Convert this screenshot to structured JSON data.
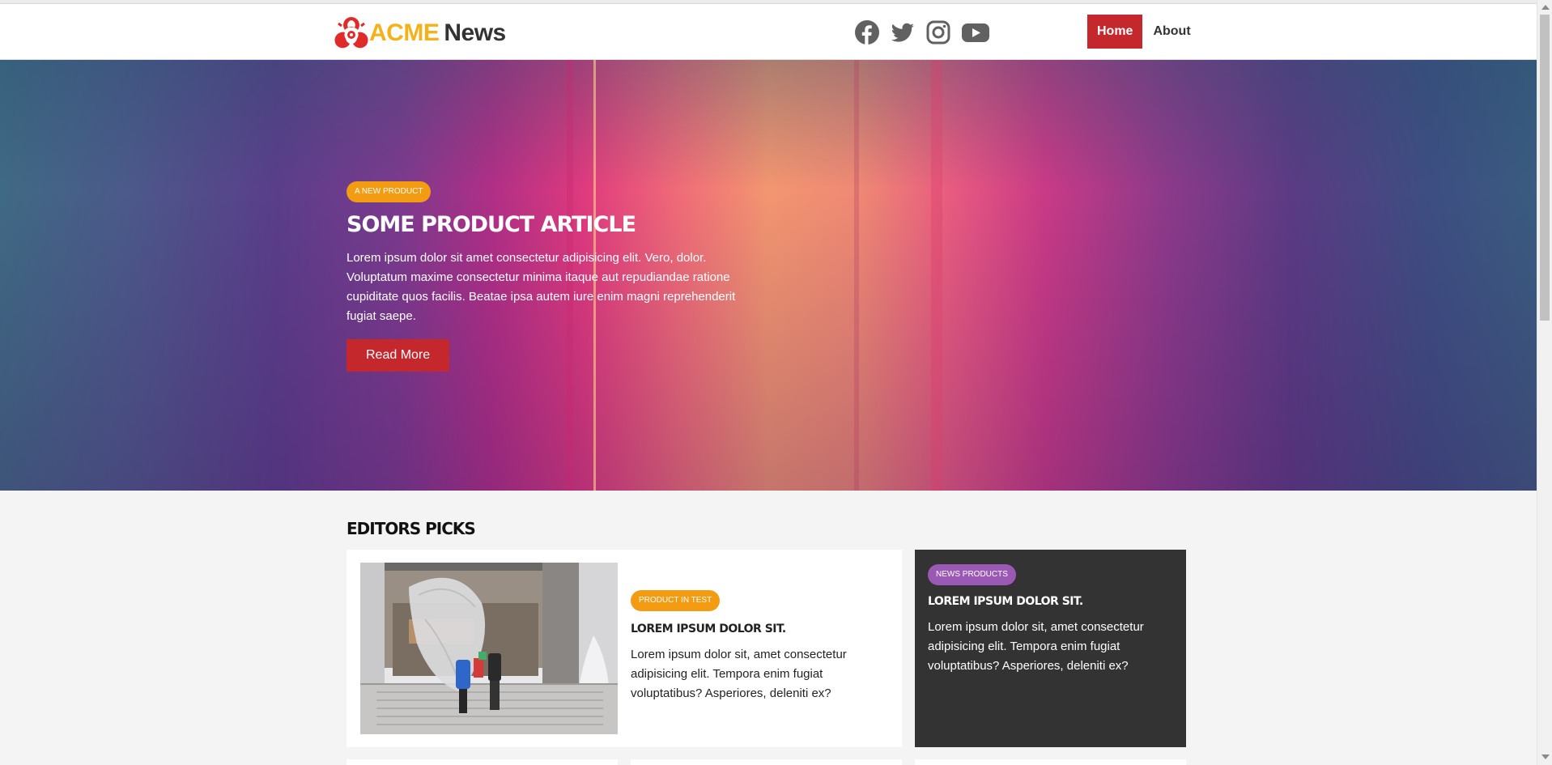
{
  "header": {
    "logo_acme": "ACME",
    "logo_news": "News",
    "socials": [
      "facebook-icon",
      "twitter-icon",
      "instagram-icon",
      "youtube-icon"
    ],
    "nav": {
      "home": "Home",
      "about": "About"
    }
  },
  "hero": {
    "tag": "A NEW PRODUCT",
    "title": "SOME PRODUCT ARTICLE",
    "text": "Lorem ipsum dolor sit amet consectetur adipisicing elit. Vero, dolor. Voluptatum maxime consectetur minima itaque aut repudiandae ratione cupiditate quos facilis. Beatae ipsa autem iure enim magni reprehenderit fugiat saepe.",
    "button": "Read More"
  },
  "editors_picks": {
    "title": "EDITORS PICKS",
    "cards": [
      {
        "tag": "PRODUCT IN TEST",
        "title": "LOREM IPSUM DOLOR SIT.",
        "text": "Lorem ipsum dolor sit, amet consectetur adipisicing elit. Tempora enim fugiat voluptatibus? Asperiores, deleniti ex?"
      },
      {
        "tag": "NEWS PRODUCTS",
        "title": "LOREM IPSUM DOLOR SIT.",
        "text": "Lorem ipsum dolor sit, amet consectetur adipisicing elit. Tempora enim fugiat voluptatibus? Asperiores, deleniti ex?"
      }
    ]
  },
  "colors": {
    "accent_red": "#c4272c",
    "tag_orange": "#f39c12",
    "tag_purple": "#9b59b6",
    "dark_card": "#333333",
    "logo_yellow": "#f3b21b"
  }
}
